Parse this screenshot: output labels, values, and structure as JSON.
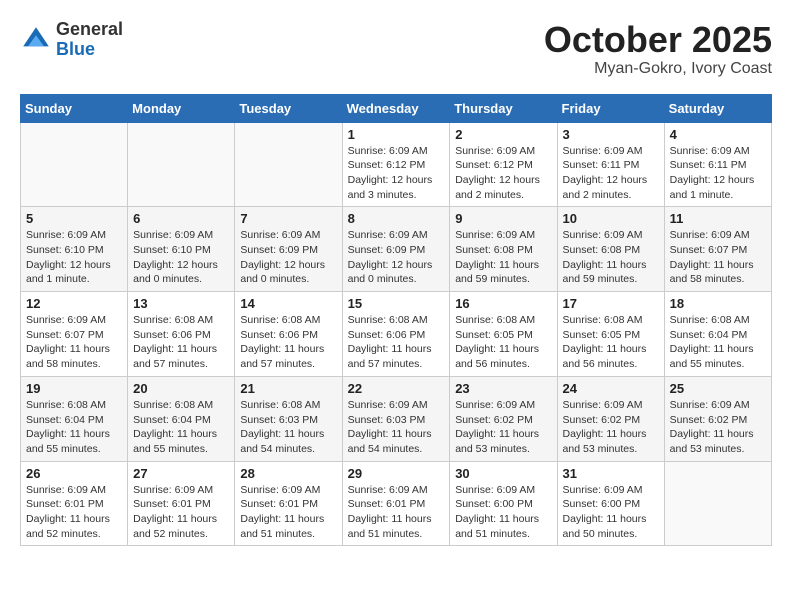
{
  "header": {
    "logo_general": "General",
    "logo_blue": "Blue",
    "month_title": "October 2025",
    "location": "Myan-Gokro, Ivory Coast"
  },
  "weekdays": [
    "Sunday",
    "Monday",
    "Tuesday",
    "Wednesday",
    "Thursday",
    "Friday",
    "Saturday"
  ],
  "weeks": [
    [
      {
        "day": "",
        "info": ""
      },
      {
        "day": "",
        "info": ""
      },
      {
        "day": "",
        "info": ""
      },
      {
        "day": "1",
        "info": "Sunrise: 6:09 AM\nSunset: 6:12 PM\nDaylight: 12 hours\nand 3 minutes."
      },
      {
        "day": "2",
        "info": "Sunrise: 6:09 AM\nSunset: 6:12 PM\nDaylight: 12 hours\nand 2 minutes."
      },
      {
        "day": "3",
        "info": "Sunrise: 6:09 AM\nSunset: 6:11 PM\nDaylight: 12 hours\nand 2 minutes."
      },
      {
        "day": "4",
        "info": "Sunrise: 6:09 AM\nSunset: 6:11 PM\nDaylight: 12 hours\nand 1 minute."
      }
    ],
    [
      {
        "day": "5",
        "info": "Sunrise: 6:09 AM\nSunset: 6:10 PM\nDaylight: 12 hours\nand 1 minute."
      },
      {
        "day": "6",
        "info": "Sunrise: 6:09 AM\nSunset: 6:10 PM\nDaylight: 12 hours\nand 0 minutes."
      },
      {
        "day": "7",
        "info": "Sunrise: 6:09 AM\nSunset: 6:09 PM\nDaylight: 12 hours\nand 0 minutes."
      },
      {
        "day": "8",
        "info": "Sunrise: 6:09 AM\nSunset: 6:09 PM\nDaylight: 12 hours\nand 0 minutes."
      },
      {
        "day": "9",
        "info": "Sunrise: 6:09 AM\nSunset: 6:08 PM\nDaylight: 11 hours\nand 59 minutes."
      },
      {
        "day": "10",
        "info": "Sunrise: 6:09 AM\nSunset: 6:08 PM\nDaylight: 11 hours\nand 59 minutes."
      },
      {
        "day": "11",
        "info": "Sunrise: 6:09 AM\nSunset: 6:07 PM\nDaylight: 11 hours\nand 58 minutes."
      }
    ],
    [
      {
        "day": "12",
        "info": "Sunrise: 6:09 AM\nSunset: 6:07 PM\nDaylight: 11 hours\nand 58 minutes."
      },
      {
        "day": "13",
        "info": "Sunrise: 6:08 AM\nSunset: 6:06 PM\nDaylight: 11 hours\nand 57 minutes."
      },
      {
        "day": "14",
        "info": "Sunrise: 6:08 AM\nSunset: 6:06 PM\nDaylight: 11 hours\nand 57 minutes."
      },
      {
        "day": "15",
        "info": "Sunrise: 6:08 AM\nSunset: 6:06 PM\nDaylight: 11 hours\nand 57 minutes."
      },
      {
        "day": "16",
        "info": "Sunrise: 6:08 AM\nSunset: 6:05 PM\nDaylight: 11 hours\nand 56 minutes."
      },
      {
        "day": "17",
        "info": "Sunrise: 6:08 AM\nSunset: 6:05 PM\nDaylight: 11 hours\nand 56 minutes."
      },
      {
        "day": "18",
        "info": "Sunrise: 6:08 AM\nSunset: 6:04 PM\nDaylight: 11 hours\nand 55 minutes."
      }
    ],
    [
      {
        "day": "19",
        "info": "Sunrise: 6:08 AM\nSunset: 6:04 PM\nDaylight: 11 hours\nand 55 minutes."
      },
      {
        "day": "20",
        "info": "Sunrise: 6:08 AM\nSunset: 6:04 PM\nDaylight: 11 hours\nand 55 minutes."
      },
      {
        "day": "21",
        "info": "Sunrise: 6:08 AM\nSunset: 6:03 PM\nDaylight: 11 hours\nand 54 minutes."
      },
      {
        "day": "22",
        "info": "Sunrise: 6:09 AM\nSunset: 6:03 PM\nDaylight: 11 hours\nand 54 minutes."
      },
      {
        "day": "23",
        "info": "Sunrise: 6:09 AM\nSunset: 6:02 PM\nDaylight: 11 hours\nand 53 minutes."
      },
      {
        "day": "24",
        "info": "Sunrise: 6:09 AM\nSunset: 6:02 PM\nDaylight: 11 hours\nand 53 minutes."
      },
      {
        "day": "25",
        "info": "Sunrise: 6:09 AM\nSunset: 6:02 PM\nDaylight: 11 hours\nand 53 minutes."
      }
    ],
    [
      {
        "day": "26",
        "info": "Sunrise: 6:09 AM\nSunset: 6:01 PM\nDaylight: 11 hours\nand 52 minutes."
      },
      {
        "day": "27",
        "info": "Sunrise: 6:09 AM\nSunset: 6:01 PM\nDaylight: 11 hours\nand 52 minutes."
      },
      {
        "day": "28",
        "info": "Sunrise: 6:09 AM\nSunset: 6:01 PM\nDaylight: 11 hours\nand 51 minutes."
      },
      {
        "day": "29",
        "info": "Sunrise: 6:09 AM\nSunset: 6:01 PM\nDaylight: 11 hours\nand 51 minutes."
      },
      {
        "day": "30",
        "info": "Sunrise: 6:09 AM\nSunset: 6:00 PM\nDaylight: 11 hours\nand 51 minutes."
      },
      {
        "day": "31",
        "info": "Sunrise: 6:09 AM\nSunset: 6:00 PM\nDaylight: 11 hours\nand 50 minutes."
      },
      {
        "day": "",
        "info": ""
      }
    ]
  ]
}
